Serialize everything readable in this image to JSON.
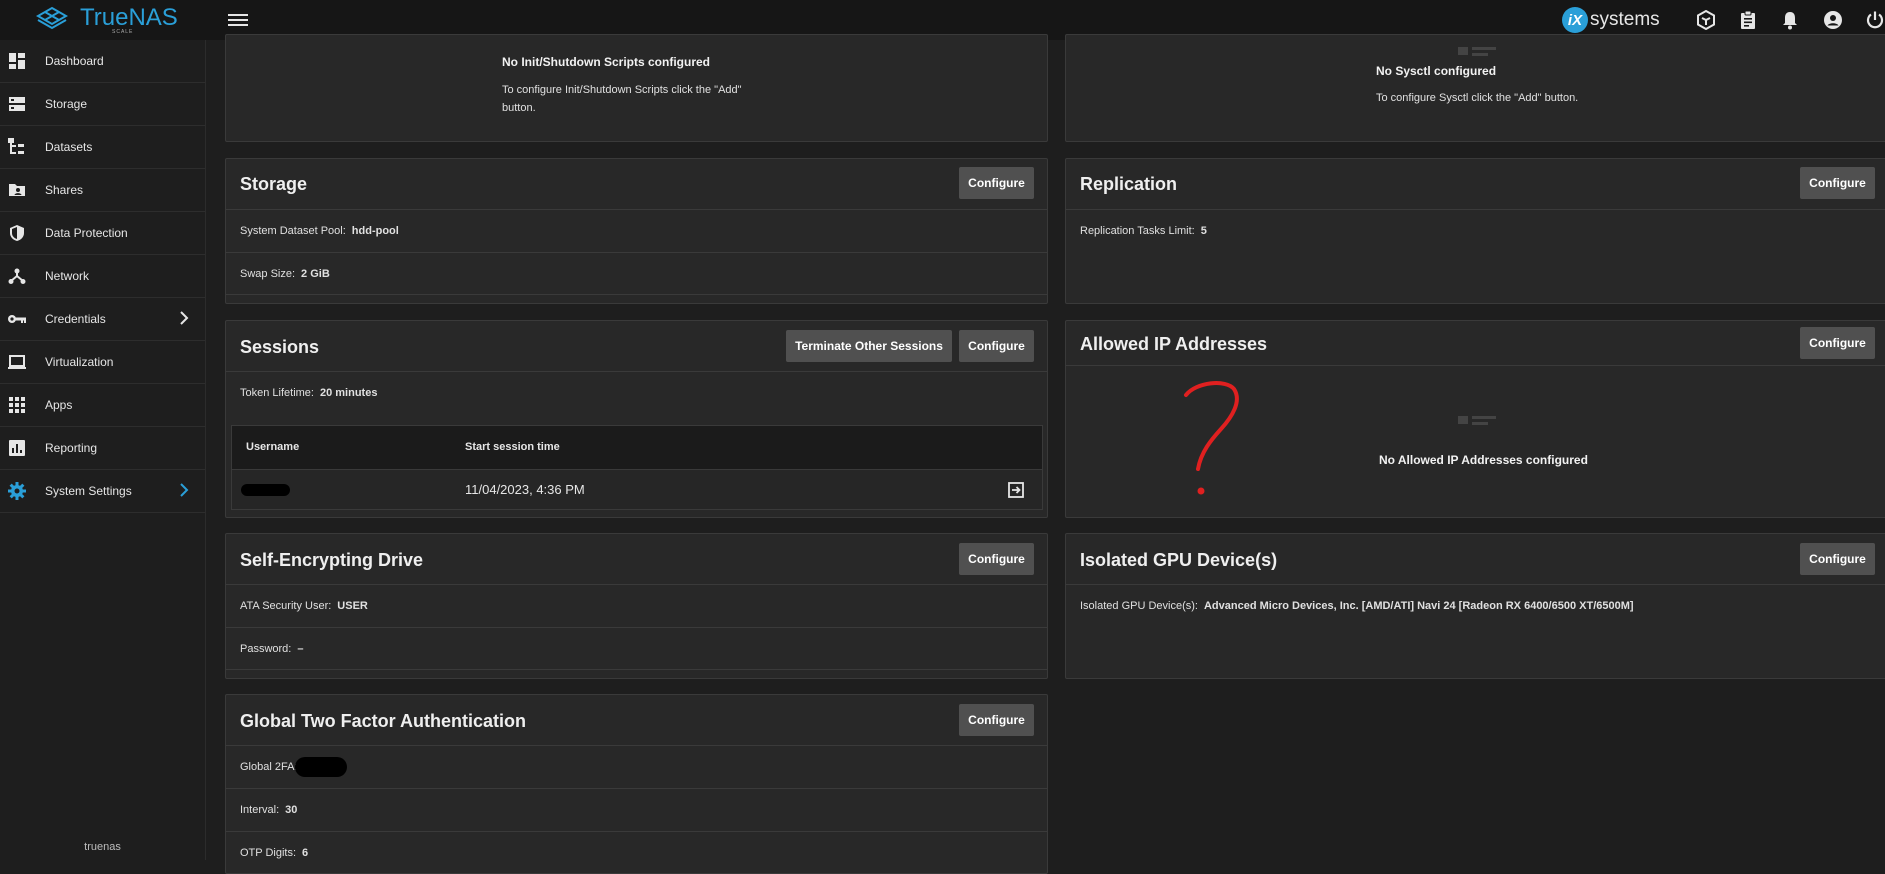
{
  "topbar": {
    "logo_text": "TrueNAS",
    "logo_subtext": "SCALE",
    "vendor_logo_mark": "iX",
    "vendor_logo_text": "systems",
    "icons": [
      "truecommand-icon",
      "clipboard-icon",
      "bell-icon",
      "account-icon",
      "power-icon"
    ]
  },
  "sidebar": {
    "items": [
      {
        "label": "Dashboard",
        "icon": "dashboard-icon"
      },
      {
        "label": "Storage",
        "icon": "storage-icon"
      },
      {
        "label": "Datasets",
        "icon": "datasets-icon"
      },
      {
        "label": "Shares",
        "icon": "shares-icon"
      },
      {
        "label": "Data Protection",
        "icon": "shield-icon"
      },
      {
        "label": "Network",
        "icon": "network-icon"
      },
      {
        "label": "Credentials",
        "icon": "key-icon"
      },
      {
        "label": "Virtualization",
        "icon": "laptop-icon"
      },
      {
        "label": "Apps",
        "icon": "apps-icon"
      },
      {
        "label": "Reporting",
        "icon": "reporting-icon"
      },
      {
        "label": "System Settings",
        "icon": "gear-icon"
      }
    ],
    "hostname": "truenas",
    "accent_color": "#2a9fd8"
  },
  "init_scripts": {
    "empty_title": "No Init/Shutdown Scripts configured",
    "empty_text": "To configure Init/Shutdown Scripts click the \"Add\" button."
  },
  "sysctl": {
    "empty_title": "No Sysctl configured",
    "empty_text": "To configure Sysctl click the \"Add\" button."
  },
  "storage": {
    "title": "Storage",
    "configure_label": "Configure",
    "pool_label": "System Dataset Pool:",
    "pool_value": "hdd-pool",
    "swap_label": "Swap Size:",
    "swap_value": "2 GiB"
  },
  "replication": {
    "title": "Replication",
    "configure_label": "Configure",
    "limit_label": "Replication Tasks Limit:",
    "limit_value": "5"
  },
  "sessions": {
    "title": "Sessions",
    "terminate_label": "Terminate Other Sessions",
    "configure_label": "Configure",
    "token_label": "Token Lifetime:",
    "token_value": "20 minutes",
    "col_username": "Username",
    "col_start": "Start session time",
    "rows": [
      {
        "start": "11/04/2023, 4:36 PM"
      }
    ]
  },
  "allowed_ip": {
    "title": "Allowed IP Addresses",
    "configure_label": "Configure",
    "empty_title": "No Allowed IP Addresses configured"
  },
  "sed": {
    "title": "Self-Encrypting Drive",
    "configure_label": "Configure",
    "user_label": "ATA Security User:",
    "user_value": "USER",
    "password_label": "Password:",
    "password_value": "–"
  },
  "gpu": {
    "title": "Isolated GPU Device(s)",
    "configure_label": "Configure",
    "device_label": "Isolated GPU Device(s):",
    "device_value": "Advanced Micro Devices, Inc. [AMD/ATI] Navi 24 [Radeon RX 6400/6500 XT/6500M]"
  },
  "twofa": {
    "title": "Global Two Factor Authentication",
    "configure_label": "Configure",
    "global_label": "Global 2FA:",
    "interval_label": "Interval:",
    "interval_value": "30",
    "otp_label": "OTP Digits:",
    "otp_value": "6"
  },
  "annotation": {
    "mark": "?",
    "color": "#e02020"
  }
}
